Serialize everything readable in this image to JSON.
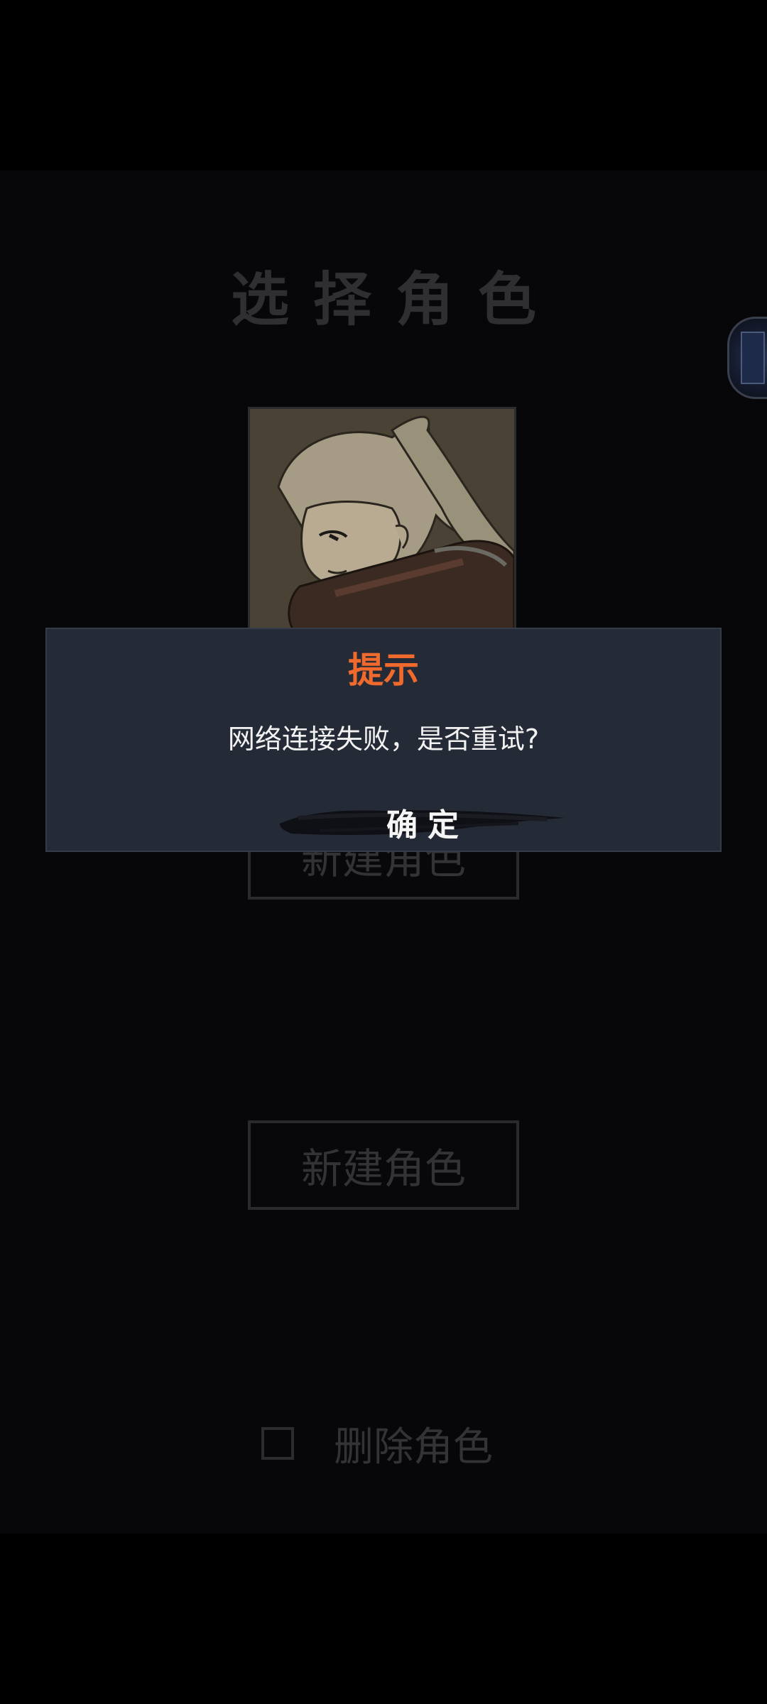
{
  "screen": {
    "title": "选择角色",
    "slots": [
      {
        "button_label": "新建角色"
      },
      {
        "button_label": "新建角色"
      }
    ],
    "delete": {
      "label": "删除角色",
      "checked": false
    }
  },
  "dialog": {
    "title": "提示",
    "message": "网络连接失败，是否重试?",
    "confirm_label": "确定",
    "title_color": "#ef6a2c"
  },
  "icons": {
    "side_tab": "side-panel-tab-icon",
    "portrait": "character-portrait"
  }
}
